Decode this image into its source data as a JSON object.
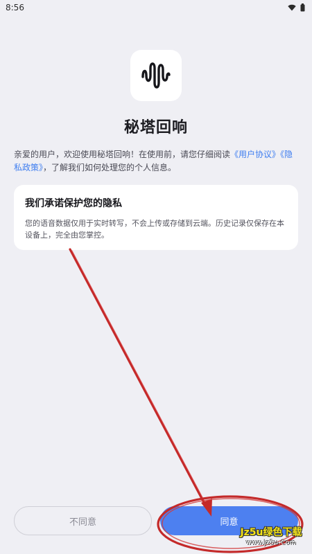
{
  "status_bar": {
    "time": "8:56",
    "wifi_icon": "wifi-icon",
    "battery_icon": "battery-icon"
  },
  "app": {
    "logo_icon": "sound-wave-icon",
    "name": "秘塔回响"
  },
  "intro": {
    "text_before": "亲爱的用户，欢迎使用秘塔回响！在使用前，请您仔细阅读",
    "user_agreement_link": "《用户协议》",
    "privacy_policy_link": "《隐私政策》",
    "text_after": "，了解我们如何处理您的个人信息。"
  },
  "privacy_card": {
    "title": "我们承诺保护您的隐私",
    "body": "您的语音数据仅用于实时转写，不会上传或存储到云端。历史记录仅保存在本设备上，完全由您掌控。"
  },
  "buttons": {
    "disagree_label": "不同意",
    "agree_label": "同意"
  },
  "watermark": {
    "main": "Jz5u绿色下载",
    "sub": "www.Jz5u.Com"
  },
  "colors": {
    "accent": "#4d80f0",
    "link": "#3f7ef0",
    "annotation": "#d22a2a",
    "background": "#efeff4"
  }
}
